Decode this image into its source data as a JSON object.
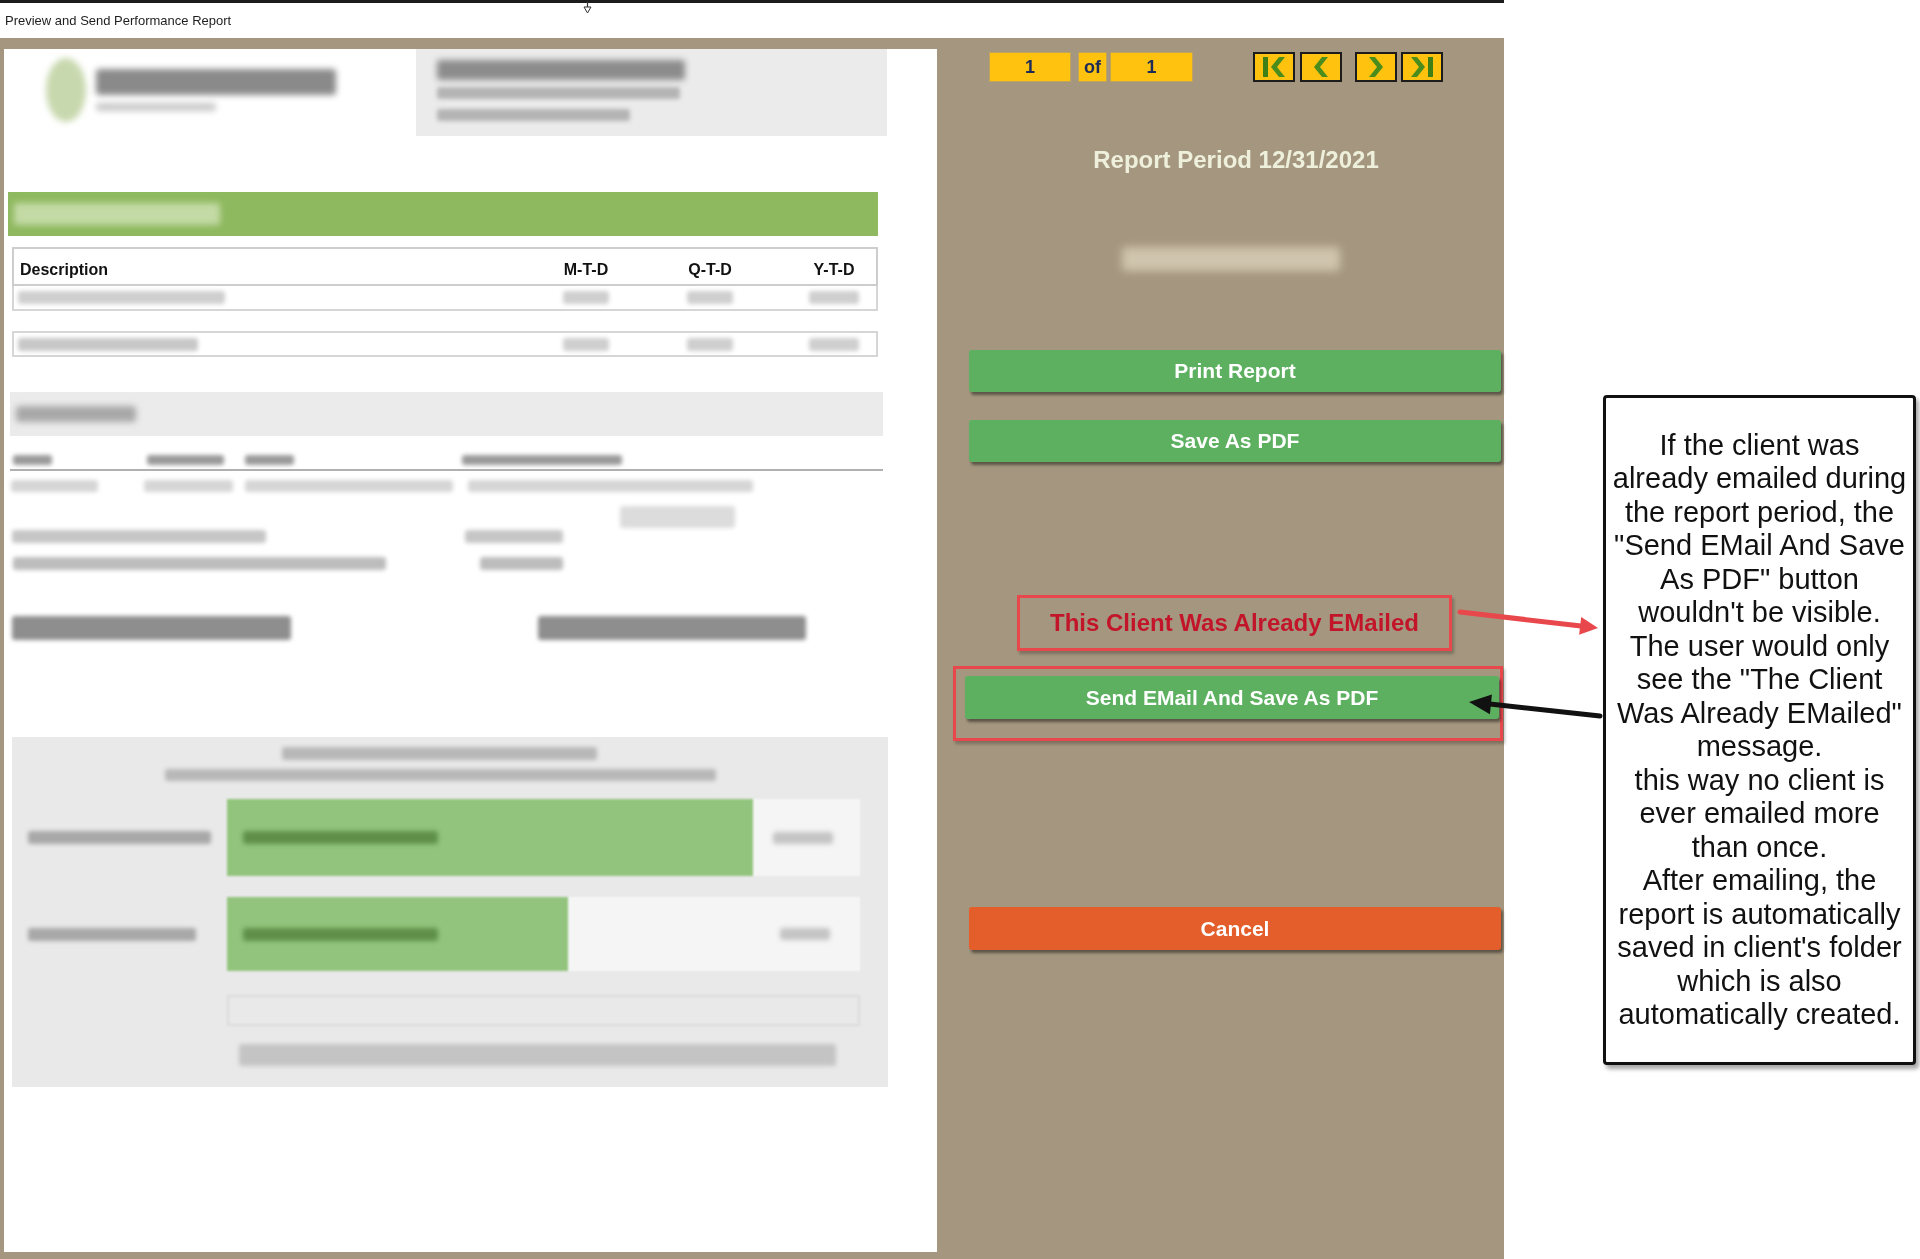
{
  "window": {
    "title": "Preview and Send Performance Report"
  },
  "report_preview": {
    "summary_table": {
      "columns": [
        "Description",
        "M-T-D",
        "Q-T-D",
        "Y-T-D"
      ]
    }
  },
  "control_panel": {
    "pager": {
      "current": "1",
      "separator": "of",
      "total": "1"
    },
    "report_period": "Report Period 12/31/2021",
    "buttons": [
      {
        "label": "Print Report",
        "kind": "primary"
      },
      {
        "label": "Save As PDF",
        "kind": "primary"
      }
    ],
    "status_message": {
      "text": "This Client Was Already EMailed",
      "highlighted": true
    },
    "send_button": {
      "label": "Send EMail And Save As PDF",
      "kind": "primary",
      "highlighted": true
    },
    "cancel_button": {
      "label": "Cancel",
      "kind": "cancel"
    }
  },
  "callout": {
    "paragraphs": [
      "If the client was already emailed during the report period, the \"Send EMail And Save As PDF\" button wouldn't be visible.",
      "The user would only see the \"The Client Was Already EMailed\" message.",
      "this way no client is ever emailed more than once.",
      "After emailing, the report is automatically saved in client's folder which is also automatically created."
    ]
  }
}
